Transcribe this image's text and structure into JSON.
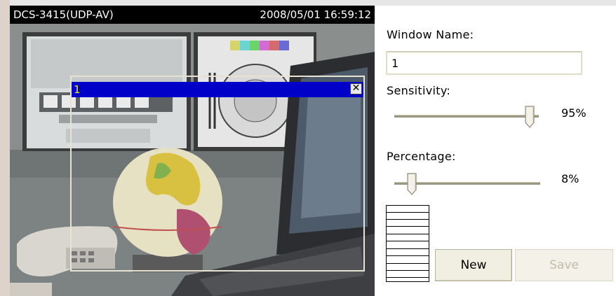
{
  "camera": {
    "title": "DCS-3415(UDP-AV)",
    "timestamp": "2008/05/01 16:59:12"
  },
  "motion_window": {
    "name": "1",
    "close_symbol": "✕",
    "titlebar_color": "#0000c8",
    "name_color": "#f4e800"
  },
  "panel": {
    "window_name_label": "Window Name:",
    "window_name_value": "1",
    "sensitivity_label": "Sensitivity:",
    "sensitivity_value": "95%",
    "sensitivity_fraction": 0.95,
    "percentage_label": "Percentage:",
    "percentage_value": "8%",
    "percentage_fraction": 0.08,
    "new_button": "New",
    "save_button": "Save"
  },
  "icons": {
    "close": "close-icon",
    "slider_thumb": "slider-thumb-icon"
  }
}
